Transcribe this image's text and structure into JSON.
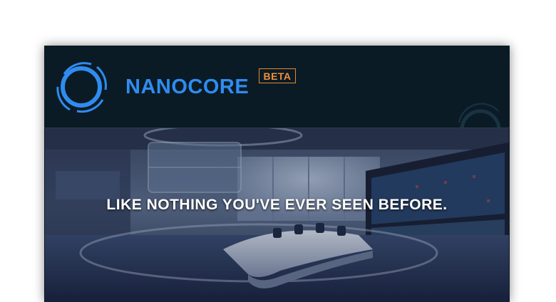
{
  "header": {
    "brand": "NANOCORE",
    "badge": "BETA",
    "logo_icon": "ring-logo-icon",
    "colors": {
      "brand": "#2f8cf0",
      "badge": "#f0913a",
      "header_bg": "#0b1b25"
    }
  },
  "hero": {
    "tagline": "LIKE NOTHING YOU'VE EVER SEEN BEFORE.",
    "image": "futuristic-control-room-image"
  }
}
